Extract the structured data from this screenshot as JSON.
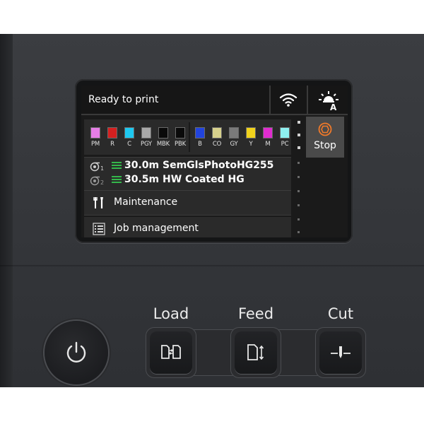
{
  "screen": {
    "status_text": "Ready to print",
    "status_icons": [
      "wifi-icon",
      "auto-light-icon"
    ],
    "light_badge": "A"
  },
  "inks": [
    {
      "code": "PM",
      "color": "#e67ee6"
    },
    {
      "code": "R",
      "color": "#d42020"
    },
    {
      "code": "C",
      "color": "#1ec8f0"
    },
    {
      "code": "PGY",
      "color": "#a8a8a8"
    },
    {
      "code": "MBK",
      "color": "#0a0a0a"
    },
    {
      "code": "PBK",
      "color": "#0a0a0a"
    },
    {
      "code": "B",
      "color": "#2244dd"
    },
    {
      "code": "CO",
      "color": "#d6d08c"
    },
    {
      "code": "GY",
      "color": "#7a7a7a"
    },
    {
      "code": "Y",
      "color": "#f0d21c"
    },
    {
      "code": "M",
      "color": "#e02ccf"
    },
    {
      "code": "PC",
      "color": "#8ef0f0"
    }
  ],
  "media": [
    {
      "roll": "1",
      "length": "30.0m",
      "name": "SemGlsPhotoHG255"
    },
    {
      "roll": "2",
      "length": "30.5m",
      "name": "HW Coated HG"
    }
  ],
  "menu": [
    {
      "label": "Maintenance",
      "icon": "maintenance-tools-icon"
    },
    {
      "label": "Job management",
      "icon": "job-list-icon"
    }
  ],
  "stop": {
    "label": "Stop",
    "accent": "#f07a2a"
  },
  "hardware": {
    "load_label": "Load",
    "feed_label": "Feed",
    "cut_label": "Cut"
  },
  "colors": {
    "level_green": "#34b84a",
    "panel": "#36383c"
  }
}
